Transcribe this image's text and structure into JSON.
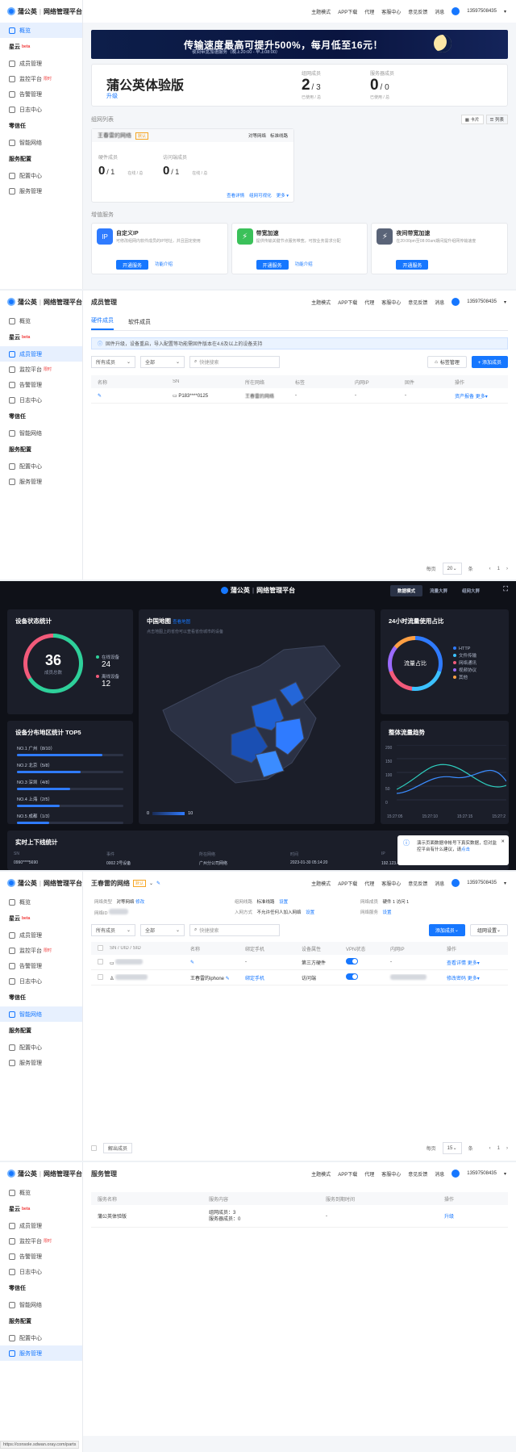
{
  "app": {
    "brand": "蒲公英",
    "product": "网络管理平台"
  },
  "topbar": {
    "items": [
      "主题模式",
      "APP下载",
      "代理",
      "客服中心",
      "意见反馈",
      "消息"
    ],
    "phone": "13597508435"
  },
  "sidebar": {
    "overview": "概览",
    "group_xingyun": "星云",
    "group_badge": "beta",
    "members": "成员管理",
    "monitor": "监控平台",
    "monitor_badge": "限时",
    "alerts": "告警管理",
    "logs": "日志中心",
    "group_zero": "零信任",
    "smart_net": "智能网络",
    "group_service": "服务配置",
    "config": "配置中心",
    "service_mgmt": "服务管理"
  },
  "overview": {
    "banner_main": "传输速度最高可提升500%，每月低至16元！",
    "banner_sub": "夜间带宽加速服务（晚上20:00 - 早上08:00）",
    "edition": "蒲公英体验版",
    "upgrade": "升级",
    "groups_label": "组网成员",
    "groups_value": "2",
    "groups_total": "/ 3",
    "groups_sub": "已使用 / 总",
    "server_label": "服务器成员",
    "server_value": "0",
    "server_total": "/ 0",
    "server_sub": "已使用 / 总",
    "list_title": "组网列表",
    "view_card": "卡片",
    "view_list": "列表",
    "net_name": "王春雷的网络",
    "net_default": "默认",
    "net_type": "对等网络",
    "net_line": "标准线路",
    "hw_label": "硬件成员",
    "hw_value": "0",
    "hw_total": "/ 1",
    "hw_online": "在线 / 总",
    "visit_label": "访问端成员",
    "visit_value": "0",
    "visit_total": "/ 1",
    "visit_online": "在线 / 总",
    "net_actions": [
      "查看详情",
      "组网可视化",
      "更多"
    ],
    "vas_title": "增值服务",
    "vas": [
      {
        "name": "自定义IP",
        "desc": "可修改组网内软件成员的IP地址，并且固定使用",
        "btn": "开通服务",
        "link": "功能介绍",
        "color": "#2f7bff",
        "icon": "IP"
      },
      {
        "name": "带宽加速",
        "desc": "提供传输关键节点服务带宽，可按业务需求分配",
        "btn": "开通服务",
        "link": "功能介绍",
        "color": "#3bc15a",
        "icon": "⚡"
      },
      {
        "name": "夜间带宽加速",
        "desc": "在20:00pm至08:00am期间提升组网传输速度",
        "btn": "开通服务",
        "link": "",
        "color": "#5a6478",
        "icon": "⚡"
      }
    ]
  },
  "members": {
    "title": "成员管理",
    "tab_hw": "硬件成员",
    "tab_sw": "软件成员",
    "notice": "固件升级，设备重启，导入配置等功能需固件版本在4.6及以上的设备支持",
    "filter_net": "所有成员",
    "filter_all": "全部",
    "search_ph": "快捷搜索",
    "tag_btn": "标签管理",
    "add_btn": "+ 添加成员",
    "headers": [
      "名称",
      "SN",
      "所在网络",
      "标签",
      "内网IP",
      "固件",
      "操作"
    ],
    "row": {
      "sn": "P183****0125",
      "net": "王春雷的网络",
      "tag": "-",
      "ip": "-",
      "fw": "-",
      "act1": "资产报备",
      "act2": "更多"
    },
    "pager": {
      "per": "每页",
      "size": "20",
      "unit": "条",
      "page": "1"
    }
  },
  "bigscreen": {
    "tabs": [
      "数据模式",
      "流量大屏",
      "组网大屏"
    ],
    "device_title": "设备状态统计",
    "total": "36",
    "total_label": "成员总数",
    "online_label": "在线设备",
    "online": "24",
    "offline_label": "离线设备",
    "offline": "12",
    "map_title": "中国地图",
    "map_link": "查看地图",
    "map_hint": "点击地图上的省份可以查看省份城市的设备",
    "map_min": "0",
    "map_max": "10",
    "traffic_title": "24小时流量使用占比",
    "traffic_center": "流量占比",
    "traffic_legend": [
      {
        "name": "HTTP",
        "color": "#2f7bff"
      },
      {
        "name": "文件传输",
        "color": "#3bc1ff"
      },
      {
        "name": "网络通讯",
        "color": "#f25a7a"
      },
      {
        "name": "视频协议",
        "color": "#9b6bff"
      },
      {
        "name": "其他",
        "color": "#ff9f43"
      }
    ],
    "top5_title": "设备分布地区统计 TOP5",
    "top5": [
      {
        "label": "NO.1 广州（8/10）",
        "pct": 0.8
      },
      {
        "label": "NO.2 北京（5/8）",
        "pct": 0.6
      },
      {
        "label": "NO.3 深圳（4/8）",
        "pct": 0.5
      },
      {
        "label": "NO.4 上海（2/5）",
        "pct": 0.4
      },
      {
        "label": "NO.5 成都（1/3）",
        "pct": 0.3
      }
    ],
    "trend_title": "整体流量趋势",
    "trend_y": [
      "200",
      "150",
      "100",
      "50",
      "0"
    ],
    "trend_x": [
      "15:27:05",
      "15:27:10",
      "15:27:15",
      "15:27:2"
    ],
    "rt_title": "实时上下线统计",
    "rt_headers": [
      "SN",
      "事件",
      "所在网络",
      "时间",
      "IP"
    ],
    "rt_row": [
      "0990****5690",
      "0002 2号设备",
      "广州分公司网络",
      "2023-01-30 05:14:20",
      "192.123.45.67（广东省广州市）"
    ],
    "toast": "演示页面数据非帐号下真实数据，您对监控平台有什么建议，请",
    "toast_link": "点击"
  },
  "smartnet": {
    "title": "王春雷的网络",
    "badge": "默认",
    "f_type_l": "网络类型",
    "f_type_v": "对等网络",
    "f_edit": "修改",
    "f_line_l": "组网线路",
    "f_line_v": "标准线路",
    "f_set": "设置",
    "f_mem_l": "网络成员",
    "f_mem_v": "硬件 1    访问 1",
    "f_id_l": "网络ID",
    "f_join_l": "入网方式",
    "f_join_v": "不允许任何人加入网络",
    "f_join_a": "设置",
    "f_srv_l": "网络服务",
    "f_srv_a": "设置",
    "filter_all": "所有成员",
    "filter2": "全部",
    "search_ph": "快捷搜索",
    "add_btn": "添加成员",
    "set_btn": "组网设置",
    "headers": [
      "SN / UID / SID",
      "名称",
      "绑定手机",
      "设备属性",
      "VPN状态",
      "内网IP",
      "操作"
    ],
    "row1": {
      "phone": "-",
      "attr": "第三方硬件",
      "ip": "-",
      "a1": "查看详情",
      "a2": "更多"
    },
    "row2": {
      "name": "王春雷的iphone",
      "phone": "绑定手机",
      "attr": "访问端",
      "a1": "修改密码",
      "a2": "更多"
    },
    "footer_del": "解出成员",
    "pager": {
      "per": "每页",
      "size": "15",
      "unit": "条",
      "page": "1"
    }
  },
  "service": {
    "title": "服务管理",
    "headers": [
      "服务名称",
      "服务内容",
      "服务到期时间",
      "操作"
    ],
    "row": {
      "name": "蒲公英体验版",
      "c1": "组网成员：3",
      "c2": "服务器成员：0",
      "exp": "-",
      "act": "升级"
    }
  },
  "status_url": "https://console.sdwan.oray.com/parts"
}
